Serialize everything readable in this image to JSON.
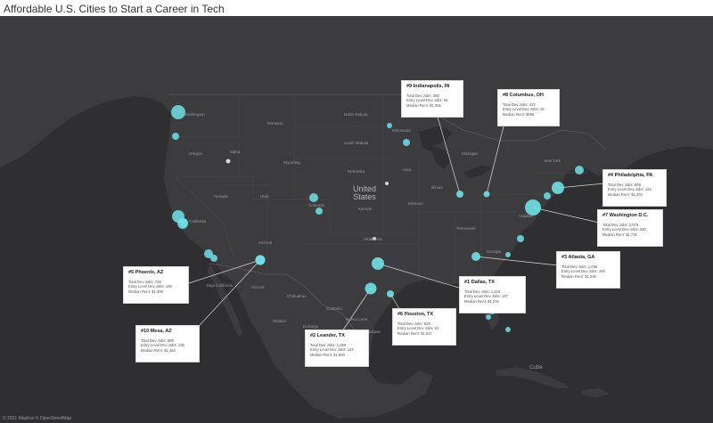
{
  "title": "Affordable U.S. Cities to Start a Career in Tech",
  "attribution": "© 2021 Mapbox © OpenStreetMap",
  "colors": {
    "background": "#ffffff",
    "map_water": "#2f2f31",
    "map_land": "#3c3c3e",
    "borders": "#5a5a5c",
    "markers": "#6fe0e6",
    "label_text": "#9a9a9a",
    "card_bg": "#ffffff"
  },
  "country_labels": {
    "united_states": [
      "United",
      "States"
    ]
  },
  "state_labels": [
    {
      "id": "washington",
      "text": "Washington"
    },
    {
      "id": "oregon",
      "text": "Oregon"
    },
    {
      "id": "idaho",
      "text": "Idaho"
    },
    {
      "id": "montana",
      "text": "Montana"
    },
    {
      "id": "wyoming",
      "text": "Wyoming"
    },
    {
      "id": "nevada",
      "text": "Nevada"
    },
    {
      "id": "utah",
      "text": "Utah"
    },
    {
      "id": "colorado",
      "text": "Colorado"
    },
    {
      "id": "california",
      "text": "California"
    },
    {
      "id": "arizona",
      "text": "Arizona"
    },
    {
      "id": "north-dakota",
      "text": "North Dakota"
    },
    {
      "id": "south-dakota",
      "text": "South Dakota"
    },
    {
      "id": "nebraska",
      "text": "Nebraska"
    },
    {
      "id": "kansas",
      "text": "Kansas"
    },
    {
      "id": "oklahoma",
      "text": "Oklahoma"
    },
    {
      "id": "missouri",
      "text": "Missouri"
    },
    {
      "id": "iowa",
      "text": "Iowa"
    },
    {
      "id": "minnesota",
      "text": "Minnesota"
    },
    {
      "id": "illinois",
      "text": "Illinois"
    },
    {
      "id": "tennessee",
      "text": "Tennessee"
    },
    {
      "id": "georgia",
      "text": "Georgia"
    },
    {
      "id": "virginia",
      "text": "Virginia"
    },
    {
      "id": "new-york",
      "text": "New York"
    },
    {
      "id": "michigan",
      "text": "Michigan"
    },
    {
      "id": "baja-california",
      "text": "Baja California"
    },
    {
      "id": "sonora",
      "text": "Sonora"
    },
    {
      "id": "chihuahua",
      "text": "Chihuahua"
    },
    {
      "id": "coahuila",
      "text": "Coahuila"
    },
    {
      "id": "durango",
      "text": "Durango"
    },
    {
      "id": "zacatecas",
      "text": "Zacatecas"
    },
    {
      "id": "tamaulipas",
      "text": "Tamaulipas"
    },
    {
      "id": "nuevo-leon",
      "text": "Nuevo León"
    },
    {
      "id": "sinaloa",
      "text": "Sinaloa"
    },
    {
      "id": "cuba",
      "text": "Cuba"
    }
  ],
  "cities": [
    {
      "id": "indianapolis",
      "title": "#9 Indianapolis, IN",
      "lines": [
        "Total Dev Jobs: 380",
        "Entry Level Dev Jobs: 65",
        "Median Rent: $1,055"
      ]
    },
    {
      "id": "columbus",
      "title": "#8 Columbus, OH",
      "lines": [
        "Total Dev Jobs: 422",
        "Entry Level Dev Jobs: 48",
        "Median Rent: $966"
      ]
    },
    {
      "id": "philadelphia",
      "title": "#4 Philadelphia, PA",
      "lines": [
        "Total Dev Jobs: 808",
        "Entry Level Dev Jobs: 124",
        "Median Rent: $1,203"
      ]
    },
    {
      "id": "washington-dc",
      "title": "#7 Washington D.C.",
      "lines": [
        "Total Dev Jobs: 3,076",
        "Entry Level Dev Jobs: 320",
        "Median Rent: $1,731"
      ]
    },
    {
      "id": "atlanta",
      "title": "#3 Atlanta, GA",
      "lines": [
        "Total Dev Jobs: 1,036",
        "Entry Level Dev Jobs: 150",
        "Median Rent: $1,236"
      ]
    },
    {
      "id": "dallas",
      "title": "#1 Dallas, TX",
      "lines": [
        "Total Dev Jobs: 1,419",
        "Entry Level Dev Jobs: 167",
        "Median Rent: $1,276"
      ]
    },
    {
      "id": "houston",
      "title": "#6 Houston, TX",
      "lines": [
        "Total Dev Jobs: 520",
        "Entry Level Dev Jobs: 51",
        "Median Rent: $1,041"
      ]
    },
    {
      "id": "leander",
      "title": "#2 Leander, TX",
      "lines": [
        "Total Dev Jobs: 1,059",
        "Entry Level Dev Jobs: 122",
        "Median Rent: $1,060"
      ]
    },
    {
      "id": "phoenix",
      "title": "#5 Phoenix, AZ",
      "lines": [
        "Total Dev Jobs: 730",
        "Entry Level Dev Jobs: 139",
        "Median Rent: $1,306"
      ]
    },
    {
      "id": "mesa",
      "title": "#10 Mesa, AZ",
      "lines": [
        "Total Dev Jobs: 888",
        "Entry Level Dev Jobs: 130",
        "Median Rent: $1,464"
      ]
    }
  ]
}
